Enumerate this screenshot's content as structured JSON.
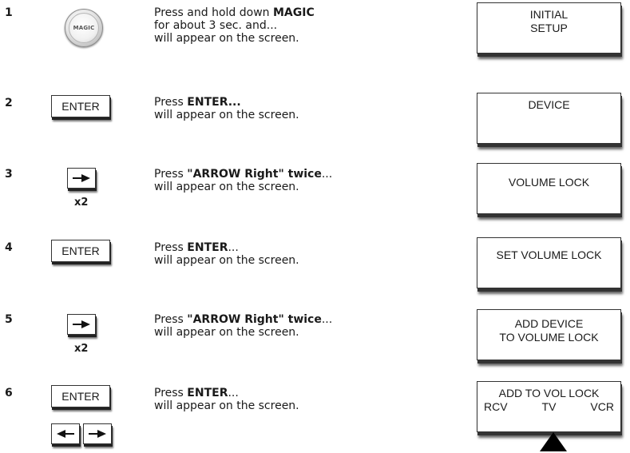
{
  "steps": [
    {
      "number": "1",
      "button": {
        "label": "MAGIC",
        "icon": "magic-button-icon"
      },
      "text": {
        "pre": "Press and hold down ",
        "bold": "MAGIC",
        "post": "",
        "line2": "for about 3 sec. and...",
        "line3": "will appear on the screen."
      },
      "screen": {
        "line1": "INITIAL",
        "line2": "SETUP"
      }
    },
    {
      "number": "2",
      "button": {
        "label": "ENTER"
      },
      "text": {
        "pre": "Press ",
        "bold": "ENTER...",
        "post": "",
        "line2": "will appear on the screen."
      },
      "screen": {
        "line1": "DEVICE"
      }
    },
    {
      "number": "3",
      "button": {
        "icon": "arrow-right-icon",
        "repeat": "x2"
      },
      "text": {
        "pre": "Press ",
        "bold": "\"ARROW Right\" twice",
        "post": "...",
        "line2": "will appear on the screen."
      },
      "screen": {
        "line1": "VOLUME LOCK"
      }
    },
    {
      "number": "4",
      "button": {
        "label": "ENTER"
      },
      "text": {
        "pre": "Press ",
        "bold": "ENTER",
        "post": "...",
        "line2": "will appear on the screen."
      },
      "screen": {
        "line1": "SET VOLUME LOCK"
      }
    },
    {
      "number": "5",
      "button": {
        "icon": "arrow-right-icon",
        "repeat": "x2"
      },
      "text": {
        "pre": "Press ",
        "bold": "\"ARROW Right\" twice",
        "post": "...",
        "line2": "will appear on the screen."
      },
      "screen": {
        "line1": "ADD DEVICE",
        "line2": "TO VOLUME LOCK"
      }
    },
    {
      "number": "6",
      "button": {
        "label": "ENTER",
        "extra_icons": [
          "arrow-left-icon",
          "arrow-right-icon"
        ]
      },
      "text": {
        "pre": "Press ",
        "bold": "ENTER",
        "post": "...",
        "line2": "will appear on the screen."
      },
      "screen": {
        "line1": "ADD TO VOL LOCK",
        "devices": [
          "RCV",
          "TV",
          "VCR"
        ],
        "selected_device": "TV"
      }
    }
  ]
}
